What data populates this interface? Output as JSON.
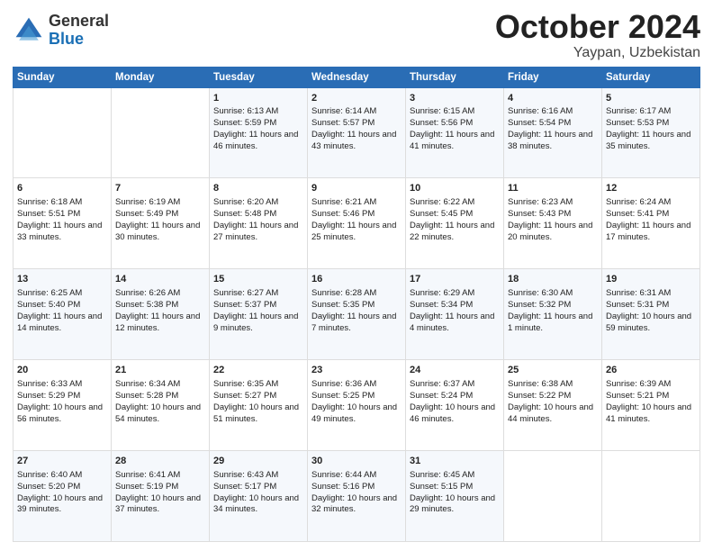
{
  "logo": {
    "general": "General",
    "blue": "Blue"
  },
  "header": {
    "month": "October 2024",
    "location": "Yaypan, Uzbekistan"
  },
  "weekdays": [
    "Sunday",
    "Monday",
    "Tuesday",
    "Wednesday",
    "Thursday",
    "Friday",
    "Saturday"
  ],
  "weeks": [
    [
      {
        "day": "",
        "content": ""
      },
      {
        "day": "",
        "content": ""
      },
      {
        "day": "1",
        "content": "Sunrise: 6:13 AM\nSunset: 5:59 PM\nDaylight: 11 hours and 46 minutes."
      },
      {
        "day": "2",
        "content": "Sunrise: 6:14 AM\nSunset: 5:57 PM\nDaylight: 11 hours and 43 minutes."
      },
      {
        "day": "3",
        "content": "Sunrise: 6:15 AM\nSunset: 5:56 PM\nDaylight: 11 hours and 41 minutes."
      },
      {
        "day": "4",
        "content": "Sunrise: 6:16 AM\nSunset: 5:54 PM\nDaylight: 11 hours and 38 minutes."
      },
      {
        "day": "5",
        "content": "Sunrise: 6:17 AM\nSunset: 5:53 PM\nDaylight: 11 hours and 35 minutes."
      }
    ],
    [
      {
        "day": "6",
        "content": "Sunrise: 6:18 AM\nSunset: 5:51 PM\nDaylight: 11 hours and 33 minutes."
      },
      {
        "day": "7",
        "content": "Sunrise: 6:19 AM\nSunset: 5:49 PM\nDaylight: 11 hours and 30 minutes."
      },
      {
        "day": "8",
        "content": "Sunrise: 6:20 AM\nSunset: 5:48 PM\nDaylight: 11 hours and 27 minutes."
      },
      {
        "day": "9",
        "content": "Sunrise: 6:21 AM\nSunset: 5:46 PM\nDaylight: 11 hours and 25 minutes."
      },
      {
        "day": "10",
        "content": "Sunrise: 6:22 AM\nSunset: 5:45 PM\nDaylight: 11 hours and 22 minutes."
      },
      {
        "day": "11",
        "content": "Sunrise: 6:23 AM\nSunset: 5:43 PM\nDaylight: 11 hours and 20 minutes."
      },
      {
        "day": "12",
        "content": "Sunrise: 6:24 AM\nSunset: 5:41 PM\nDaylight: 11 hours and 17 minutes."
      }
    ],
    [
      {
        "day": "13",
        "content": "Sunrise: 6:25 AM\nSunset: 5:40 PM\nDaylight: 11 hours and 14 minutes."
      },
      {
        "day": "14",
        "content": "Sunrise: 6:26 AM\nSunset: 5:38 PM\nDaylight: 11 hours and 12 minutes."
      },
      {
        "day": "15",
        "content": "Sunrise: 6:27 AM\nSunset: 5:37 PM\nDaylight: 11 hours and 9 minutes."
      },
      {
        "day": "16",
        "content": "Sunrise: 6:28 AM\nSunset: 5:35 PM\nDaylight: 11 hours and 7 minutes."
      },
      {
        "day": "17",
        "content": "Sunrise: 6:29 AM\nSunset: 5:34 PM\nDaylight: 11 hours and 4 minutes."
      },
      {
        "day": "18",
        "content": "Sunrise: 6:30 AM\nSunset: 5:32 PM\nDaylight: 11 hours and 1 minute."
      },
      {
        "day": "19",
        "content": "Sunrise: 6:31 AM\nSunset: 5:31 PM\nDaylight: 10 hours and 59 minutes."
      }
    ],
    [
      {
        "day": "20",
        "content": "Sunrise: 6:33 AM\nSunset: 5:29 PM\nDaylight: 10 hours and 56 minutes."
      },
      {
        "day": "21",
        "content": "Sunrise: 6:34 AM\nSunset: 5:28 PM\nDaylight: 10 hours and 54 minutes."
      },
      {
        "day": "22",
        "content": "Sunrise: 6:35 AM\nSunset: 5:27 PM\nDaylight: 10 hours and 51 minutes."
      },
      {
        "day": "23",
        "content": "Sunrise: 6:36 AM\nSunset: 5:25 PM\nDaylight: 10 hours and 49 minutes."
      },
      {
        "day": "24",
        "content": "Sunrise: 6:37 AM\nSunset: 5:24 PM\nDaylight: 10 hours and 46 minutes."
      },
      {
        "day": "25",
        "content": "Sunrise: 6:38 AM\nSunset: 5:22 PM\nDaylight: 10 hours and 44 minutes."
      },
      {
        "day": "26",
        "content": "Sunrise: 6:39 AM\nSunset: 5:21 PM\nDaylight: 10 hours and 41 minutes."
      }
    ],
    [
      {
        "day": "27",
        "content": "Sunrise: 6:40 AM\nSunset: 5:20 PM\nDaylight: 10 hours and 39 minutes."
      },
      {
        "day": "28",
        "content": "Sunrise: 6:41 AM\nSunset: 5:19 PM\nDaylight: 10 hours and 37 minutes."
      },
      {
        "day": "29",
        "content": "Sunrise: 6:43 AM\nSunset: 5:17 PM\nDaylight: 10 hours and 34 minutes."
      },
      {
        "day": "30",
        "content": "Sunrise: 6:44 AM\nSunset: 5:16 PM\nDaylight: 10 hours and 32 minutes."
      },
      {
        "day": "31",
        "content": "Sunrise: 6:45 AM\nSunset: 5:15 PM\nDaylight: 10 hours and 29 minutes."
      },
      {
        "day": "",
        "content": ""
      },
      {
        "day": "",
        "content": ""
      }
    ]
  ]
}
